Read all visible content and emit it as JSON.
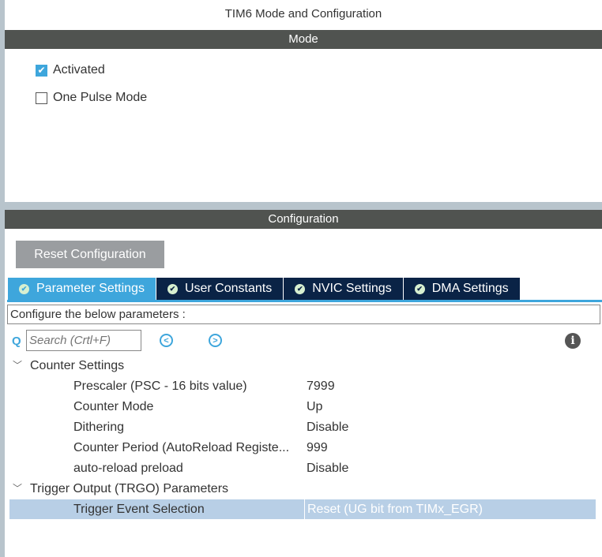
{
  "title": "TIM6 Mode and Configuration",
  "mode": {
    "header": "Mode",
    "activated": {
      "label": "Activated",
      "checked": true
    },
    "one_pulse": {
      "label": "One Pulse Mode",
      "checked": false
    }
  },
  "config": {
    "header": "Configuration",
    "reset_label": "Reset Configuration",
    "tabs": [
      {
        "label": "Parameter Settings"
      },
      {
        "label": "User Constants"
      },
      {
        "label": "NVIC Settings"
      },
      {
        "label": "DMA Settings"
      }
    ],
    "hint": "Configure the below parameters :",
    "search_placeholder": "Search (Crtl+F)",
    "groups": [
      {
        "label": "Counter Settings",
        "params": [
          {
            "name": "Prescaler (PSC - 16 bits value)",
            "value": "7999"
          },
          {
            "name": "Counter Mode",
            "value": "Up"
          },
          {
            "name": "Dithering",
            "value": "Disable"
          },
          {
            "name": "Counter Period (AutoReload Registe...",
            "value": "999"
          },
          {
            "name": "auto-reload preload",
            "value": "Disable"
          }
        ]
      },
      {
        "label": "Trigger Output (TRGO) Parameters",
        "params": [
          {
            "name": "Trigger Event Selection",
            "value": "Reset (UG bit from TIMx_EGR)"
          }
        ]
      }
    ]
  },
  "colors": {
    "accent": "#3ea6dc",
    "tab_dark": "#0a2346",
    "bar": "#505350",
    "selected": "#b8cfe6"
  }
}
